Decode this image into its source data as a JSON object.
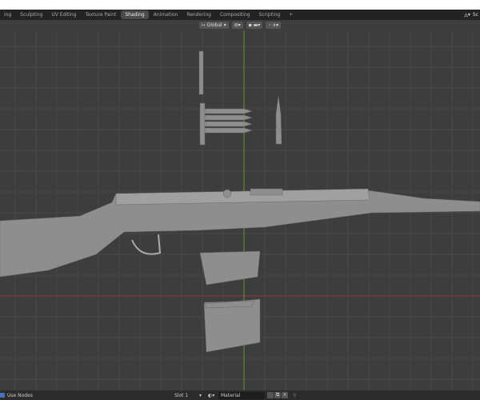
{
  "workspace_tabs": [
    "ing",
    "Sculpting",
    "UV Editing",
    "Texture Paint",
    "Shading",
    "Animation",
    "Rendering",
    "Compositing",
    "Scripting",
    "+"
  ],
  "active_tab": "Shading",
  "scene_label": "Sc",
  "header": {
    "orientation": "Global",
    "icons": [
      "transform-orientation-icon",
      "pivot-icon",
      "snap-icon",
      "proportional-edit-icon"
    ]
  },
  "bottom": {
    "use_nodes": "Use Nodes",
    "slot": "Slot 1",
    "material": "Material"
  },
  "colors": {
    "x_axis": "#8a3b3b",
    "y_axis": "#6f8f2a",
    "viewport": "#3d3d3d"
  }
}
